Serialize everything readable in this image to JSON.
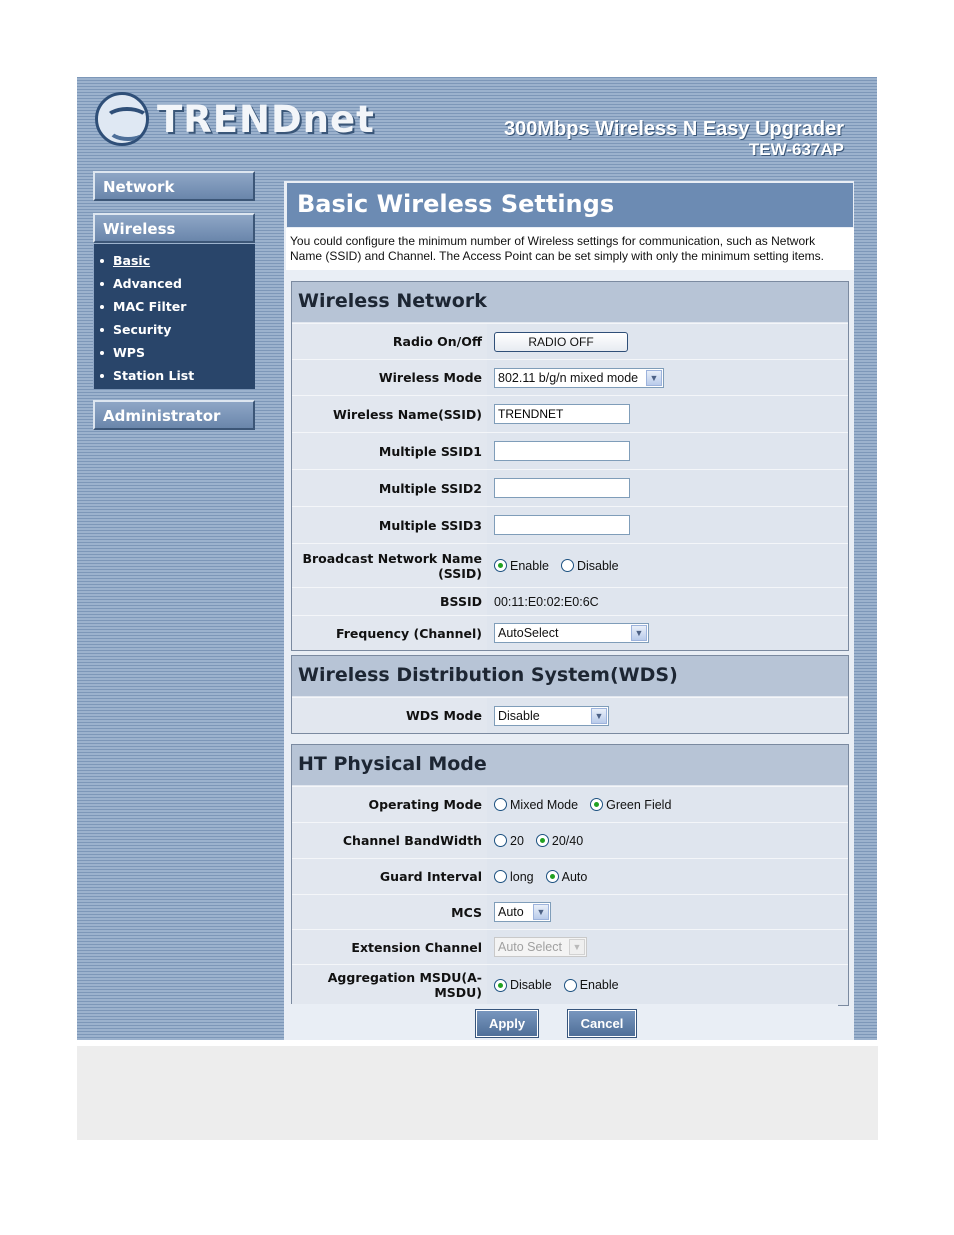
{
  "header": {
    "logo_text": "TRENDnet",
    "product_name": "300Mbps Wireless N Easy Upgrader",
    "model": "TEW-637AP"
  },
  "sidebar": {
    "network_label": "Network",
    "wireless_label": "Wireless",
    "administrator_label": "Administrator",
    "wireless_items": [
      {
        "label": "Basic"
      },
      {
        "label": "Advanced"
      },
      {
        "label": "MAC Filter"
      },
      {
        "label": "Security"
      },
      {
        "label": "WPS"
      },
      {
        "label": "Station List"
      }
    ]
  },
  "page": {
    "title": "Basic Wireless Settings",
    "intro": "You could configure the minimum number of Wireless settings for communication, such as Network Name (SSID) and Channel. The Access Point can be set simply with only the minimum setting items."
  },
  "wireless_network": {
    "heading": "Wireless Network",
    "radio_label": "Radio On/Off",
    "radio_button": "RADIO OFF",
    "mode_label": "Wireless Mode",
    "mode_value": "802.11 b/g/n mixed mode",
    "ssid_label": "Wireless Name(SSID)",
    "ssid_value": "TRENDNET",
    "ssid1_label": "Multiple SSID1",
    "ssid2_label": "Multiple SSID2",
    "ssid3_label": "Multiple SSID3",
    "broadcast_label": "Broadcast Network Name (SSID)",
    "broadcast_enable": "Enable",
    "broadcast_disable": "Disable",
    "bssid_label": "BSSID",
    "bssid_value": "00:11:E0:02:E0:6C",
    "frequency_label": "Frequency (Channel)",
    "frequency_value": "AutoSelect"
  },
  "wds": {
    "heading": "Wireless Distribution System(WDS)",
    "mode_label": "WDS Mode",
    "mode_value": "Disable"
  },
  "ht": {
    "heading": "HT Physical Mode",
    "op_label": "Operating Mode",
    "op_mixed": "Mixed Mode",
    "op_green": "Green Field",
    "bw_label": "Channel BandWidth",
    "bw_20": "20",
    "bw_2040": "20/40",
    "gi_label": "Guard Interval",
    "gi_long": "long",
    "gi_auto": "Auto",
    "mcs_label": "MCS",
    "mcs_value": "Auto",
    "ext_label": "Extension Channel",
    "ext_value": "Auto Select",
    "agg_label": "Aggregation MSDU(A-MSDU)",
    "agg_disable": "Disable",
    "agg_enable": "Enable"
  },
  "actions": {
    "apply": "Apply",
    "cancel": "Cancel"
  }
}
